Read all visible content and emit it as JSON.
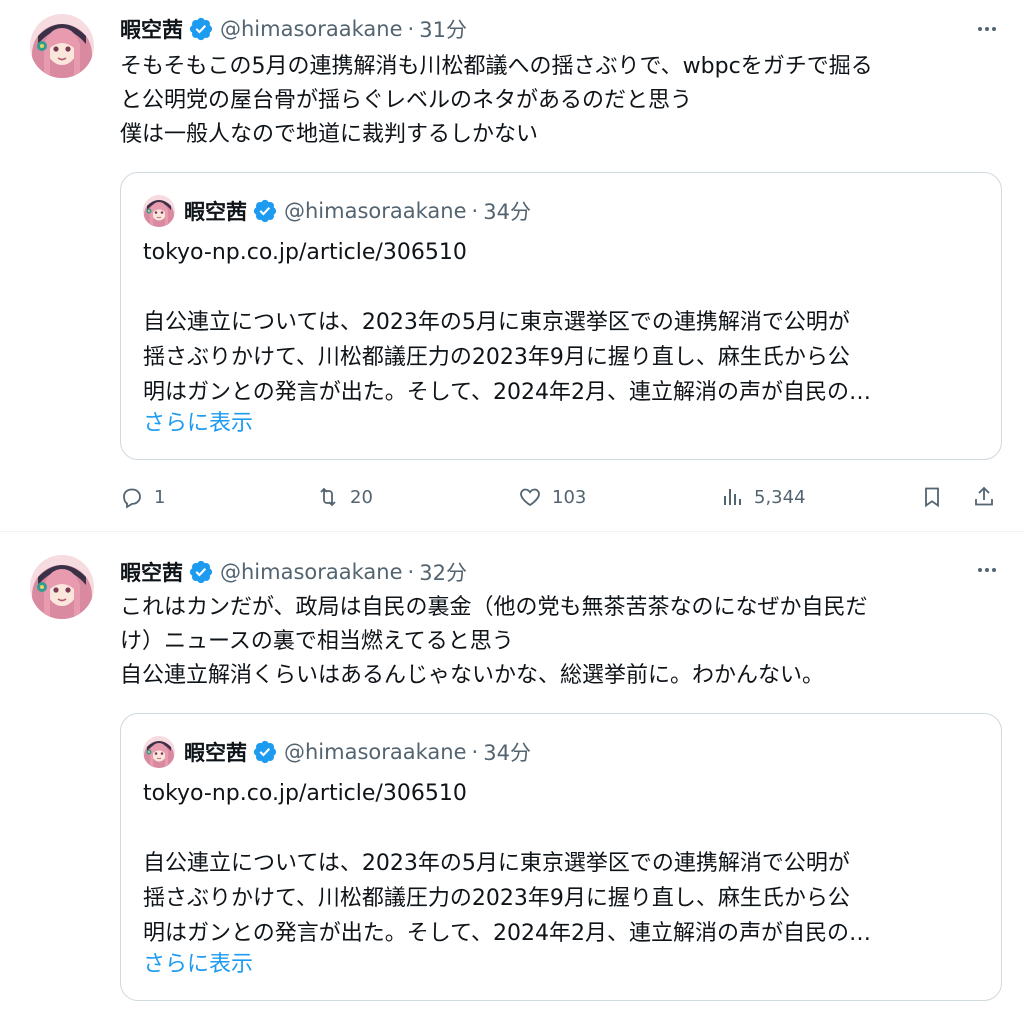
{
  "tweets": [
    {
      "name": "暇空茜",
      "handle": "@himasoraakane",
      "sep": "·",
      "time": "31分",
      "lines": [
        "そもそもこの5月の連携解消も川松都議への揺さぶりで、wbpcをガチで掘る",
        "と公明党の屋台骨が揺らぐレベルのネタがあるのだと思う",
        "僕は一般人なので地道に裁判するしかない"
      ],
      "quote": {
        "name": "暇空茜",
        "handle": "@himasoraakane",
        "sep": "·",
        "time": "34分",
        "link": "tokyo-np.co.jp/article/306510",
        "lines": [
          "自公連立については、2023年の5月に東京選挙区での連携解消で公明が",
          "揺さぶりかけて、川松都議圧力の2023年9月に握り直し、麻生氏から公",
          "明はガンとの発言が出た。そして、2024年2月、連立解消の声が自民の…"
        ],
        "show_more": "さらに表示"
      },
      "actions": {
        "reply": "1",
        "retweet": "20",
        "like": "103",
        "views": "5,344"
      }
    },
    {
      "name": "暇空茜",
      "handle": "@himasoraakane",
      "sep": "·",
      "time": "32分",
      "lines": [
        "これはカンだが、政局は自民の裏金（他の党も無茶苦茶なのになぜか自民だ",
        "け）ニュースの裏で相当燃えてると思う",
        "自公連立解消くらいはあるんじゃないかな、総選挙前に。わかんない。"
      ],
      "quote": {
        "name": "暇空茜",
        "handle": "@himasoraakane",
        "sep": "·",
        "time": "34分",
        "link": "tokyo-np.co.jp/article/306510",
        "lines": [
          "自公連立については、2023年の5月に東京選挙区での連携解消で公明が",
          "揺さぶりかけて、川松都議圧力の2023年9月に握り直し、麻生氏から公",
          "明はガンとの発言が出た。そして、2024年2月、連立解消の声が自民の…"
        ],
        "show_more": "さらに表示"
      }
    }
  ],
  "colors": {
    "text": "#0f1419",
    "secondary": "#536471",
    "link": "#1d9bf0",
    "verified": "#1d9bf0",
    "border": "#cfd9de"
  },
  "icons": {
    "verified": "verified-badge-icon",
    "more": "more-options-icon",
    "reply": "reply-icon",
    "retweet": "retweet-icon",
    "like": "heart-icon",
    "views": "views-chart-icon",
    "bookmark": "bookmark-icon",
    "share": "share-icon"
  }
}
